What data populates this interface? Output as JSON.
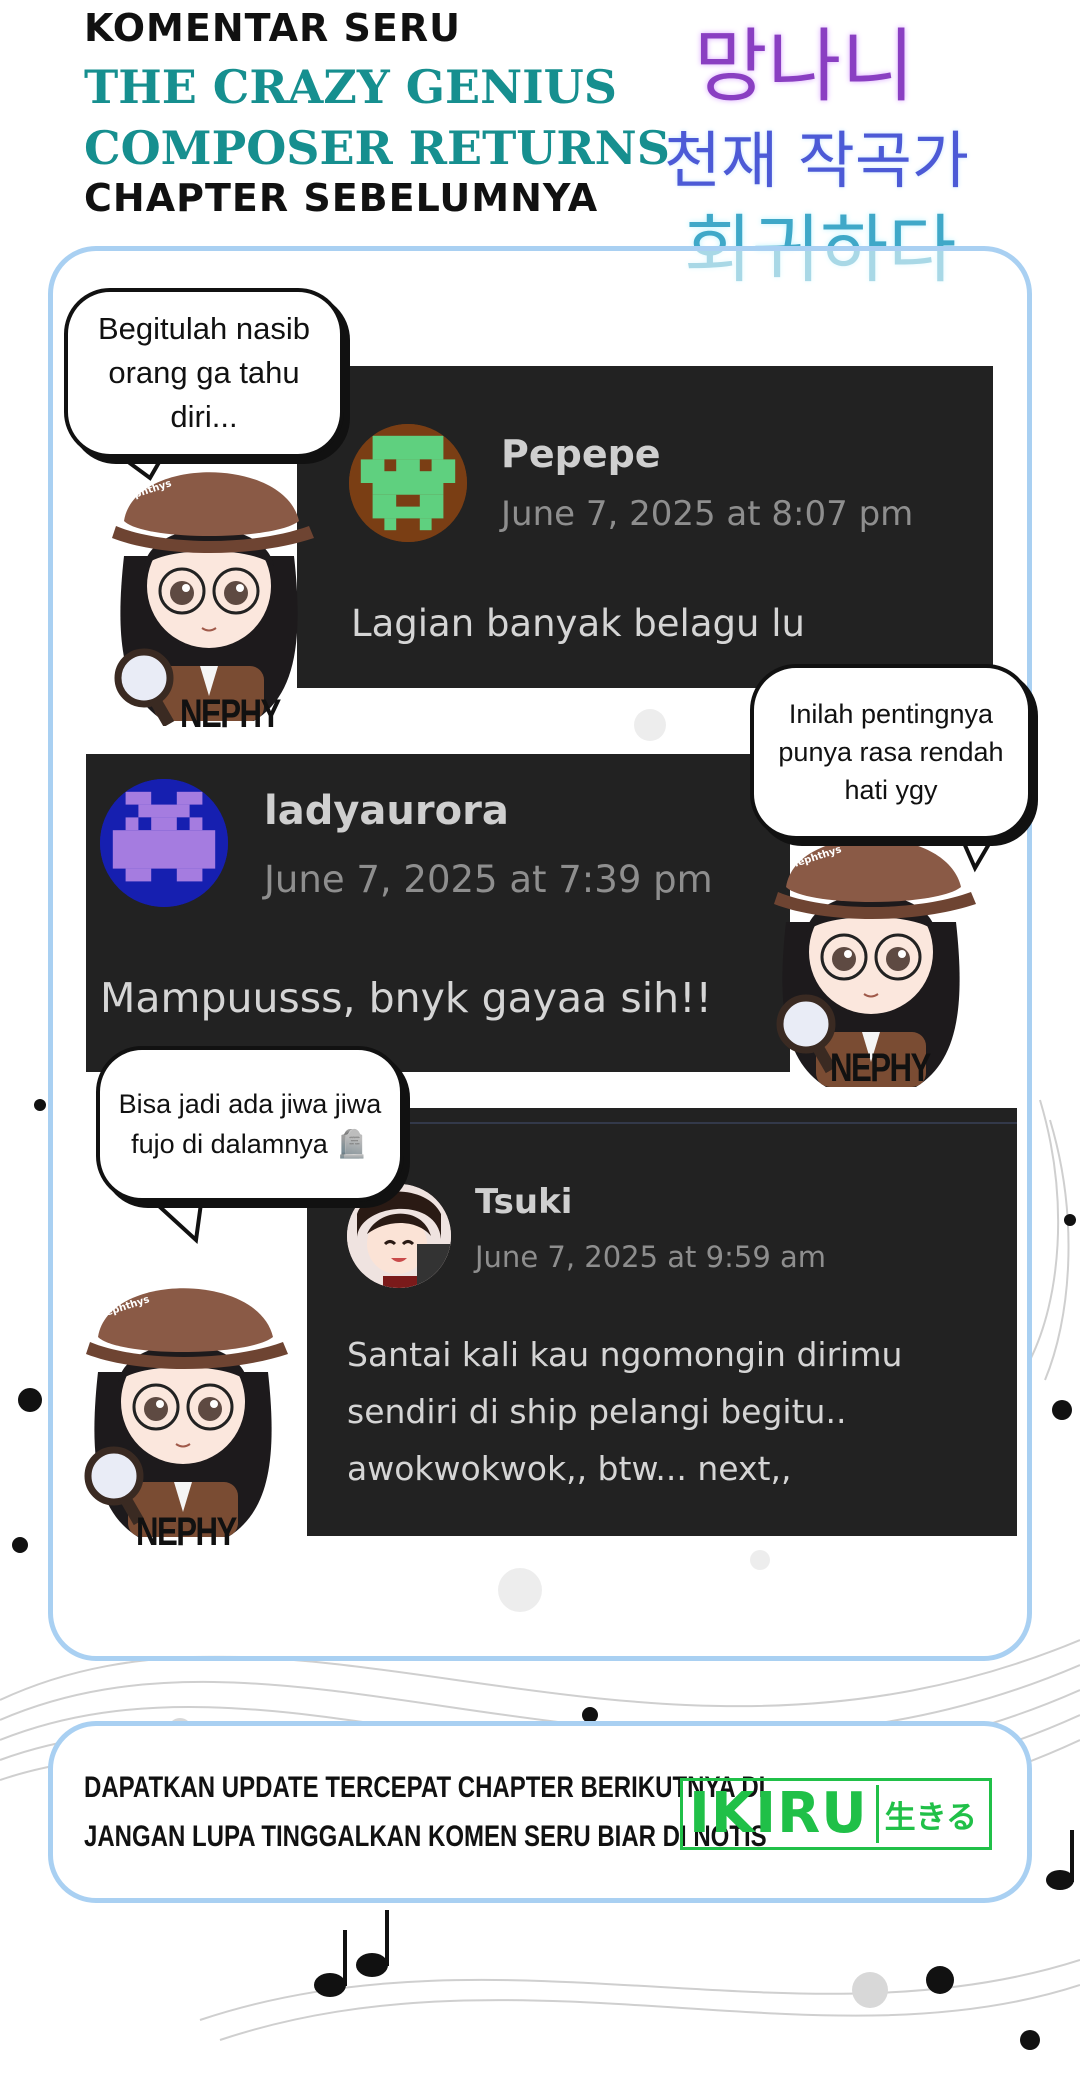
{
  "header": {
    "line1": "KOMENTAR SERU",
    "line2": "The Crazy Genius",
    "line3": "Composer Returns",
    "line4": "CHAPTER SEBELUMNYA"
  },
  "korean_logo": {
    "line1": "망나니",
    "line2": "천재 작곡가",
    "line3": "회귀하다"
  },
  "comments": [
    {
      "username": "Pepepe",
      "date": "June 7, 2025 at 8:07 pm",
      "text": "Lagian banyak belagu lu"
    },
    {
      "username": "ladyaurora",
      "date": "June 7, 2025 at 7:39 pm",
      "text": "Mampuusss, bnyk gayaa sih!!"
    },
    {
      "username": "Tsuki",
      "date": "June 7, 2025 at 9:59 am",
      "text": "Santai kali kau ngomongin dirimu\nsendiri di ship pelangi begitu..\nawokwokwok,, btw... next,,"
    }
  ],
  "bubbles": [
    "Begitulah nasib\norang ga tahu diri...",
    "Inilah pentingnya\npunya rasa rendah\nhati ygy",
    "Bisa jadi ada jiwa jiwa\nfujo di dalamnya 🪦"
  ],
  "mascot": {
    "name_label": "NEPHY",
    "hat_label": "nephthys"
  },
  "footer": {
    "line1": "DAPATKAN UPDATE TERCEPAT CHAPTER BERIKUTNYA DI",
    "line2": "JANGAN LUPA TINGGALKAN KOMEN SERU BIAR DI NOTIS",
    "logo_main": "IKIRU",
    "logo_sub": "生きる"
  },
  "colors": {
    "accent_teal": "#168f8f",
    "panel_border": "#a9d0f2",
    "comment_bg": "#222222",
    "ikiru_green": "#20c048"
  }
}
